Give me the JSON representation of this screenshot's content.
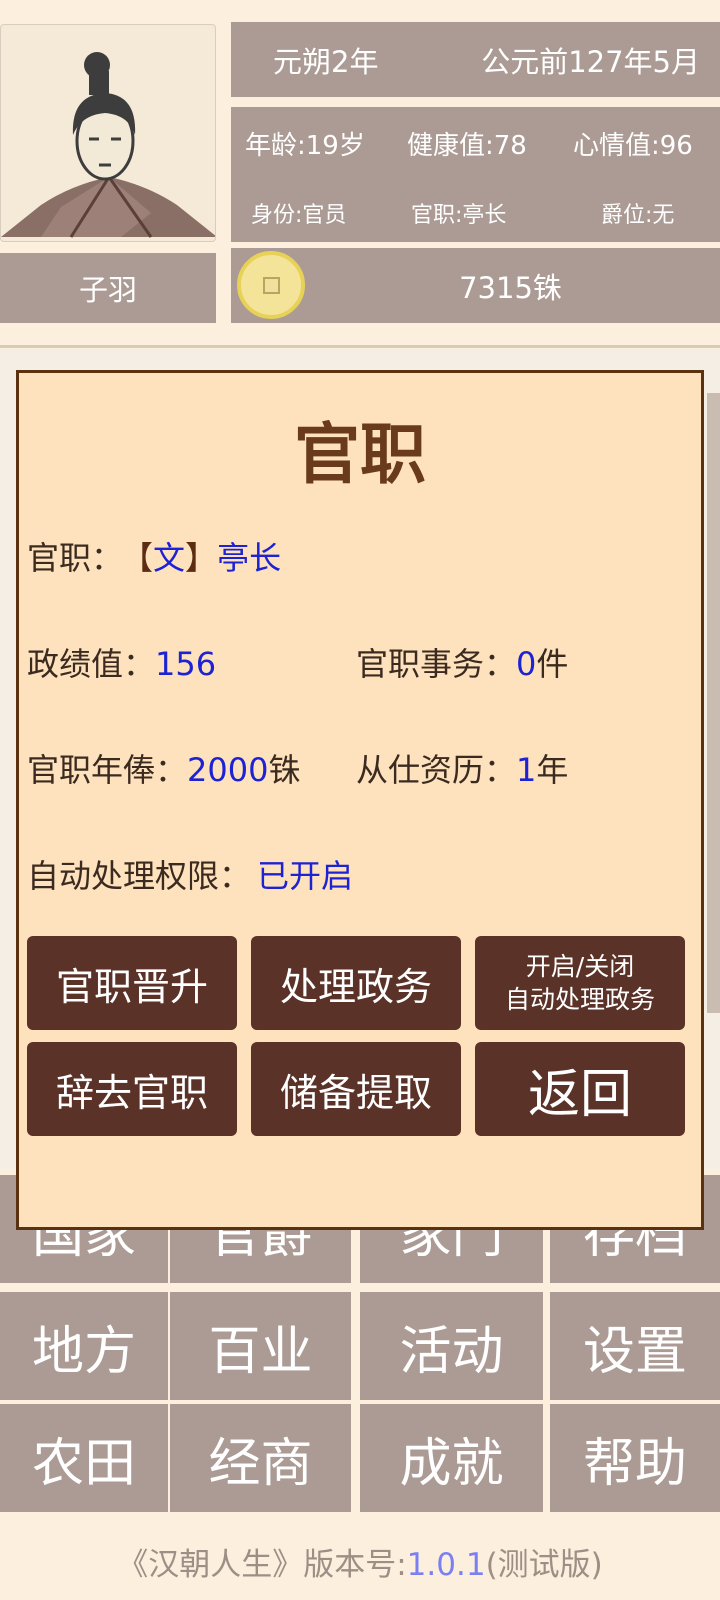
{
  "header": {
    "era_year": "元朔2年",
    "calendar_date": "公元前127年5月",
    "age": "年龄:19岁",
    "health": "健康值:78",
    "mood": "心情值:96",
    "identity": "身份:官员",
    "position": "官职:亭长",
    "nobility": "爵位:无",
    "name": "子羽",
    "money": "7315铢"
  },
  "modal": {
    "title": "官职",
    "office_label": "官职：",
    "office_bracket_open": "【",
    "office_type": "文",
    "office_bracket_close": "】",
    "office_name": "亭长",
    "merit_label": "政绩值：",
    "merit_value": "156",
    "affairs_label": "官职事务：",
    "affairs_value": "0",
    "affairs_unit": "件",
    "salary_label": "官职年俸：",
    "salary_value": "2000",
    "salary_unit": "铢",
    "tenure_label": "从仕资历：",
    "tenure_value": "1",
    "tenure_unit": "年",
    "auto_label": "自动处理权限：",
    "auto_value": "已开启",
    "buttons": {
      "promote": "官职晋升",
      "handle": "处理政务",
      "toggle_line1": "开启/关闭",
      "toggle_line2": "自动处理政务",
      "resign": "辞去官职",
      "reserve": "储备提取",
      "back": "返回"
    }
  },
  "menu": {
    "row1": [
      "国家",
      "官爵",
      "家门",
      "存档"
    ],
    "row2": [
      "地方",
      "百业",
      "活动",
      "设置"
    ],
    "row3": [
      "农田",
      "经商",
      "成就",
      "帮助"
    ]
  },
  "footer": {
    "prefix": "《汉朝人生》版本号:",
    "version": "1.0.1",
    "suffix": "(测试版)"
  },
  "colors": {
    "panel": "#ab9b94",
    "modal_bg": "#fde2bd",
    "modal_border": "#5a3210",
    "button": "#5b3227",
    "value_blue": "#1d22d2"
  }
}
